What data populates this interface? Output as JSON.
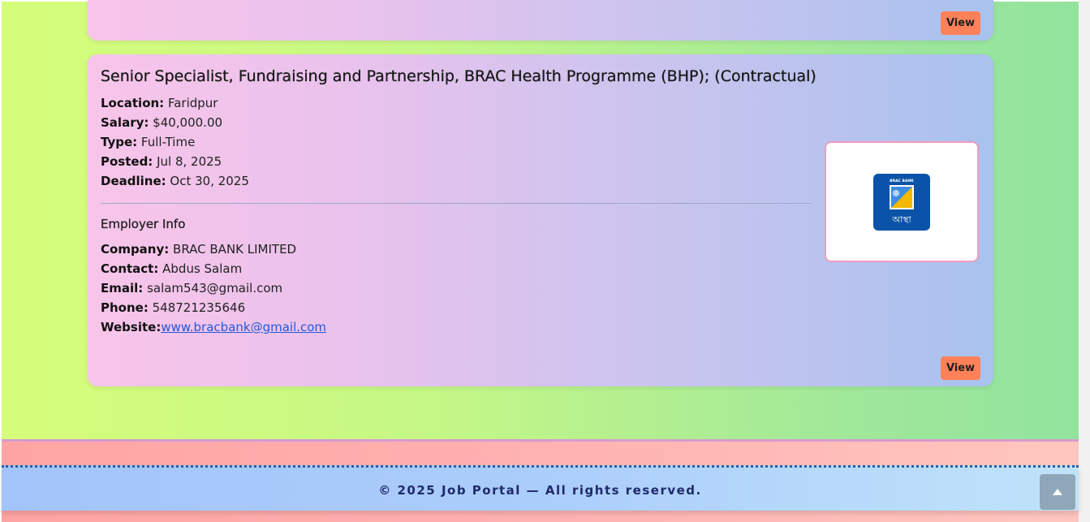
{
  "job_cards": {
    "previous": {
      "view_label": "View"
    },
    "current": {
      "title": "Senior Specialist, Fundraising and Partnership, BRAC Health Programme (BHP); (Contractual)",
      "location_label": "Location:",
      "location": "Faridpur",
      "salary_label": "Salary:",
      "salary": "$40,000.00",
      "type_label": "Type:",
      "type": "Full-Time",
      "posted_label": "Posted:",
      "posted": "Jul 8, 2025",
      "deadline_label": "Deadline:",
      "deadline": "Oct 30, 2025",
      "employer_heading": "Employer Info",
      "company_label": "Company:",
      "company": "BRAC BANK LIMITED",
      "contact_label": "Contact:",
      "contact": "Abdus Salam",
      "email_label": "Email:",
      "email": "salam543@gmail.com",
      "phone_label": "Phone:",
      "phone": "548721235646",
      "website_label": "Website:",
      "website": "www.bracbank@gmail.com",
      "logo_text_top": "BRAC BANK",
      "logo_text_bottom": "আস্থা",
      "view_label": "View"
    }
  },
  "footer": {
    "copyright": "© 2025 Job Portal — All rights reserved."
  },
  "icons": {
    "scroll_top": "chevron-up-icon",
    "company_logo": "brac-bank-logo"
  },
  "colors": {
    "view_button": "#ff8159",
    "link": "#2458d8",
    "footer_text": "#1f2a6b",
    "logo_blue": "#0b53a8",
    "logo_gold": "#f3b800"
  }
}
